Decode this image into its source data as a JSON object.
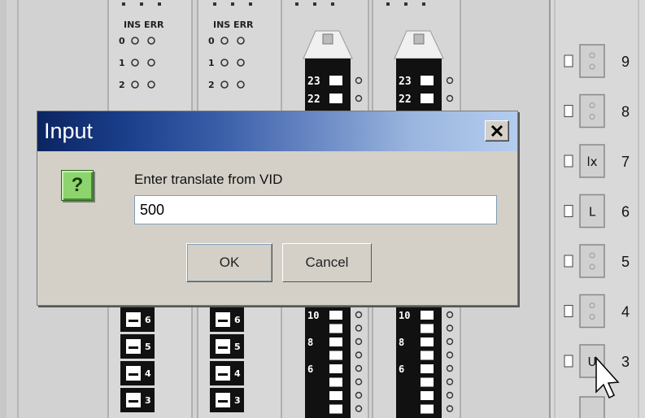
{
  "dialog": {
    "title": "Input",
    "message": "Enter translate from VID",
    "input_value": "500",
    "ok_label": "OK",
    "cancel_label": "Cancel",
    "close_icon": "close-icon",
    "question_icon": "question-icon",
    "question_glyph": "?"
  },
  "cards": {
    "col_header": "INS ERR",
    "status_rows": [
      "0",
      "1",
      "2"
    ],
    "port_top": [
      "23",
      "22"
    ],
    "port_bottom": [
      "10",
      "8",
      "6"
    ],
    "slot_numbers_bottom": [
      "6",
      "5",
      "4",
      "3"
    ]
  },
  "right_panel": {
    "slots": [
      "9",
      "8",
      "7",
      "6",
      "5",
      "4",
      "3"
    ],
    "slot_marks": {
      "7": "lx",
      "6": "L",
      "3": "U"
    }
  }
}
